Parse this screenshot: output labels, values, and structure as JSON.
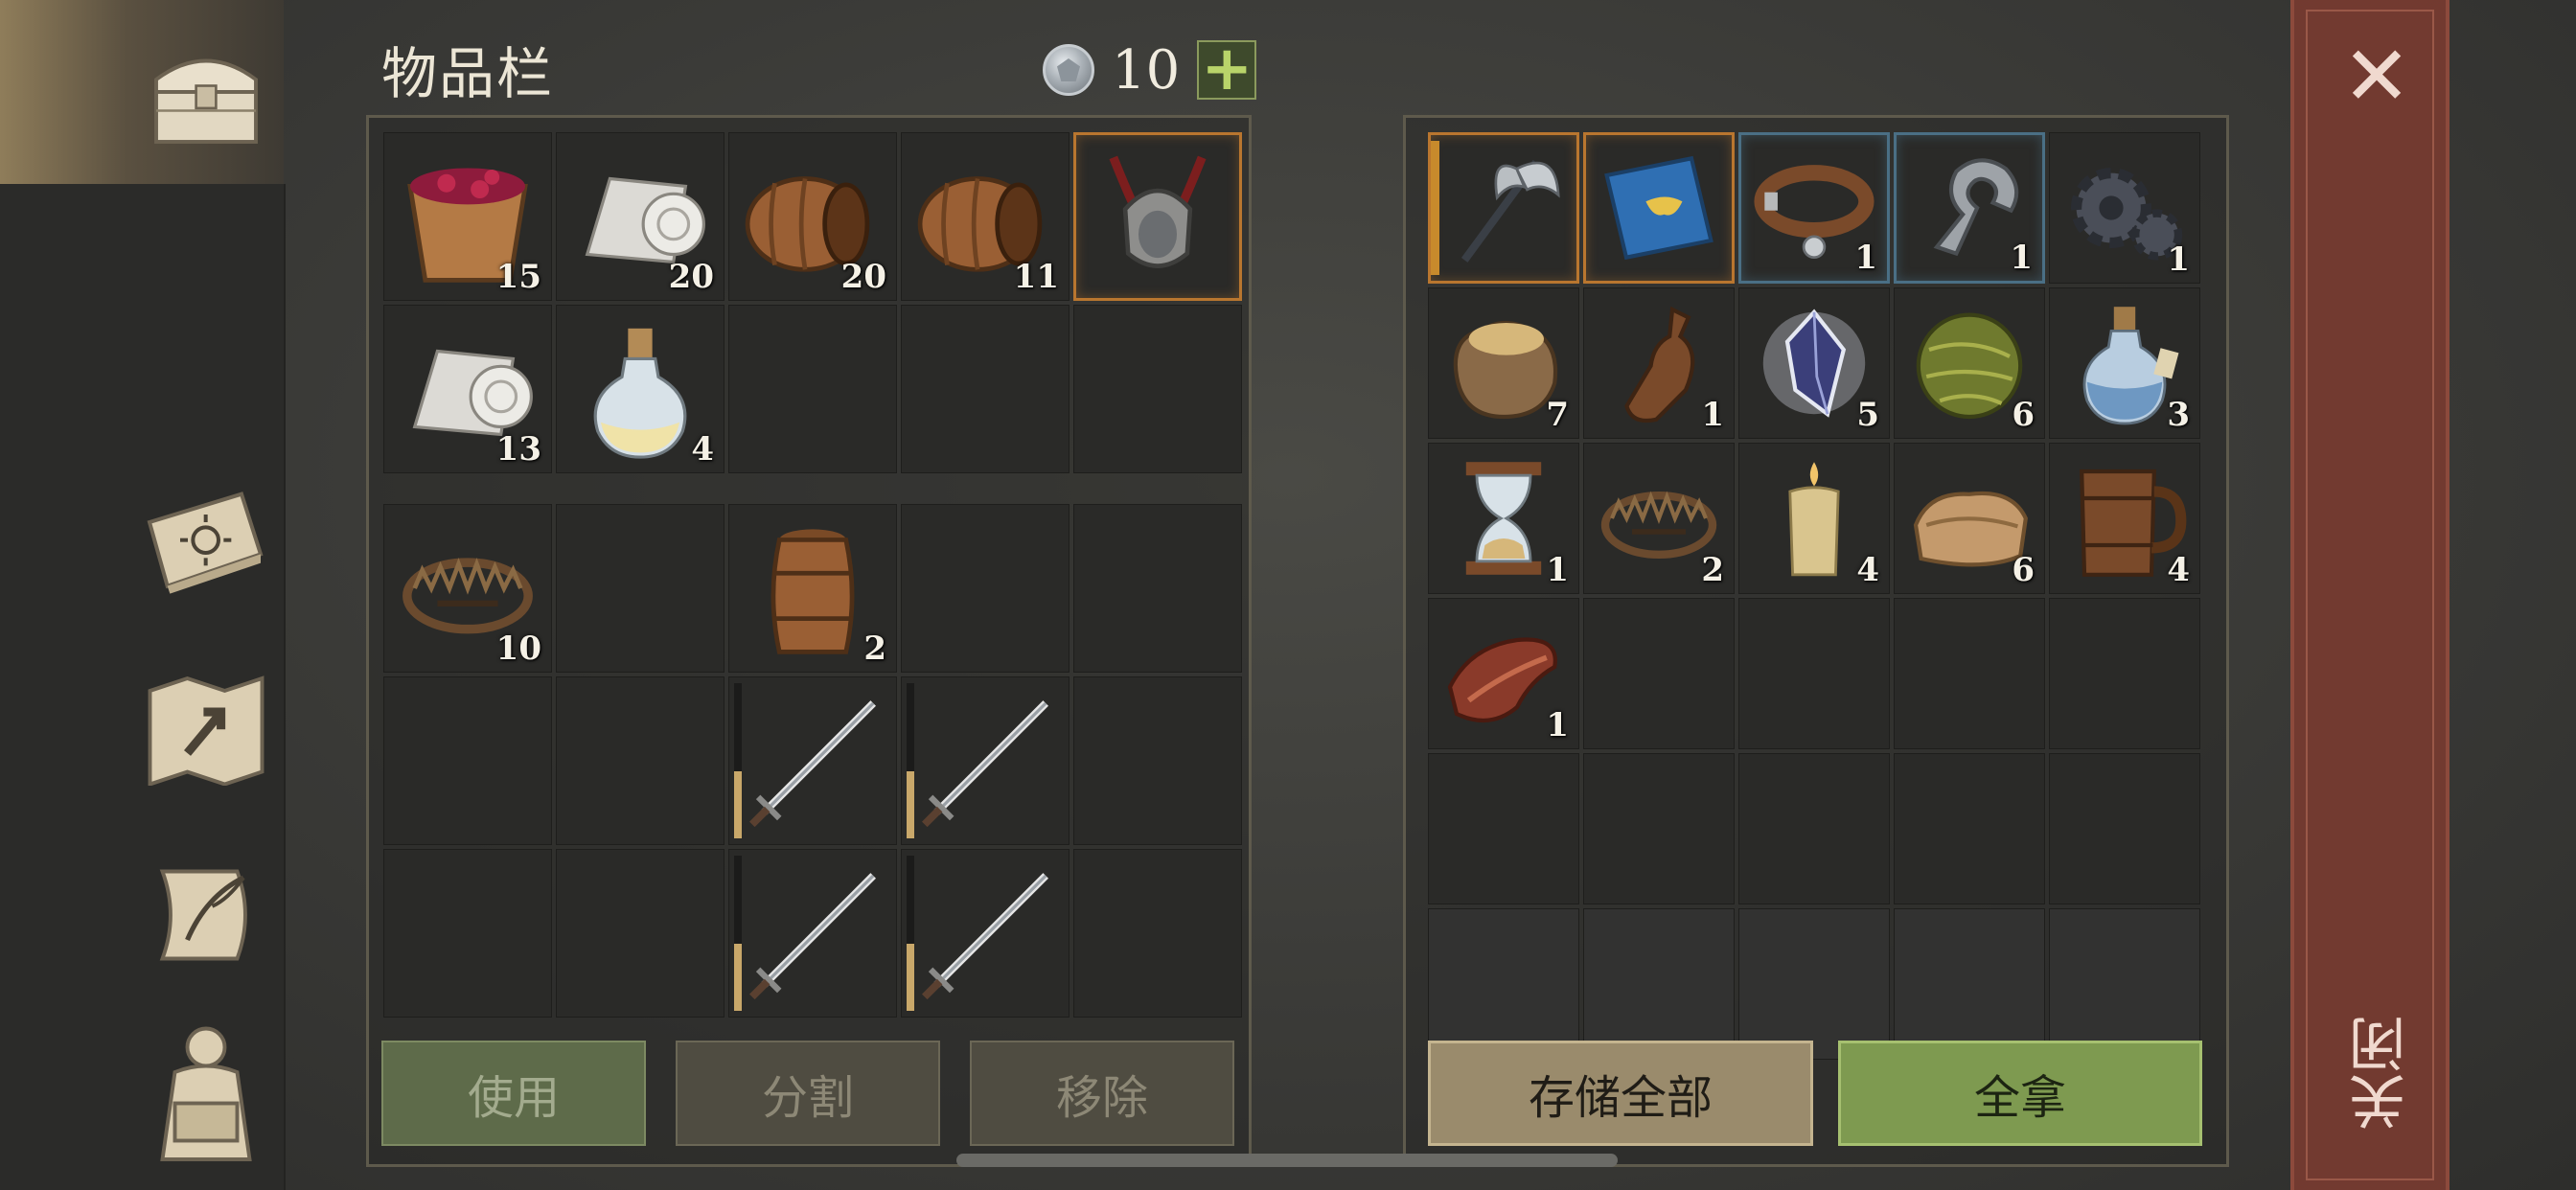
{
  "inventory": {
    "title": "物品栏",
    "currency_value": "10",
    "add_label": "+",
    "top_grid": [
      {
        "icon": "berry-bucket-icon",
        "qty": "15"
      },
      {
        "icon": "cloth-roll-icon",
        "qty": "20"
      },
      {
        "icon": "barrel-lying-icon",
        "qty": "20"
      },
      {
        "icon": "barrel-lying-icon",
        "qty": "11"
      },
      {
        "icon": "horned-helmet-icon",
        "qty": "",
        "highlight": "orange"
      },
      {
        "icon": "cloth-roll-icon",
        "qty": "13"
      },
      {
        "icon": "potion-icon",
        "qty": "4"
      },
      {
        "icon": "",
        "qty": ""
      },
      {
        "icon": "",
        "qty": ""
      },
      {
        "icon": "",
        "qty": ""
      }
    ],
    "bottom_grid": [
      {
        "icon": "bear-trap-icon",
        "qty": "10"
      },
      {
        "icon": "",
        "qty": ""
      },
      {
        "icon": "barrel-small-icon",
        "qty": "2"
      },
      {
        "icon": "",
        "qty": ""
      },
      {
        "icon": "",
        "qty": ""
      },
      {
        "icon": "",
        "qty": ""
      },
      {
        "icon": "",
        "qty": ""
      },
      {
        "icon": "sword-icon",
        "qty": "",
        "durability": 0.4
      },
      {
        "icon": "sword-icon",
        "qty": "",
        "durability": 0.3
      },
      {
        "icon": "",
        "qty": ""
      },
      {
        "icon": "",
        "qty": ""
      },
      {
        "icon": "",
        "qty": ""
      },
      {
        "icon": "sword-icon",
        "qty": "",
        "durability": 0.4
      },
      {
        "icon": "sword-icon",
        "qty": "",
        "durability": 0.4
      },
      {
        "icon": "",
        "qty": ""
      }
    ],
    "buttons": {
      "use": "使用",
      "split": "分割",
      "remove": "移除"
    }
  },
  "storage": {
    "grid": [
      {
        "icon": "battle-axe-icon",
        "qty": "",
        "highlight": "orange"
      },
      {
        "icon": "blue-book-icon",
        "qty": "",
        "highlight": "orange"
      },
      {
        "icon": "leather-collar-icon",
        "qty": "1",
        "highlight": "blue"
      },
      {
        "icon": "metal-clamp-icon",
        "qty": "1",
        "highlight": "blue"
      },
      {
        "icon": "gear-icon",
        "qty": "1"
      },
      {
        "icon": "grain-sack-icon",
        "qty": "7"
      },
      {
        "icon": "bottle-icon",
        "qty": "1"
      },
      {
        "icon": "crystal-shard-icon",
        "qty": "5"
      },
      {
        "icon": "grass-ball-icon",
        "qty": "6"
      },
      {
        "icon": "potion-blue-icon",
        "qty": "3"
      },
      {
        "icon": "hourglass-icon",
        "qty": "1"
      },
      {
        "icon": "bear-trap-icon",
        "qty": "2"
      },
      {
        "icon": "candle-icon",
        "qty": "4"
      },
      {
        "icon": "folded-cloth-icon",
        "qty": "6"
      },
      {
        "icon": "wooden-mug-icon",
        "qty": "4"
      },
      {
        "icon": "raw-meat-icon",
        "qty": "1"
      },
      {
        "icon": "",
        "qty": ""
      },
      {
        "icon": "",
        "qty": ""
      },
      {
        "icon": "",
        "qty": ""
      },
      {
        "icon": "",
        "qty": ""
      },
      {
        "icon": "",
        "qty": ""
      },
      {
        "icon": "",
        "qty": ""
      },
      {
        "icon": "",
        "qty": ""
      },
      {
        "icon": "",
        "qty": ""
      },
      {
        "icon": "",
        "qty": ""
      },
      {
        "icon": "",
        "qty": "",
        "faint": true
      },
      {
        "icon": "",
        "qty": "",
        "faint": true
      },
      {
        "icon": "",
        "qty": "",
        "faint": true
      },
      {
        "icon": "",
        "qty": "",
        "faint": true
      },
      {
        "icon": "",
        "qty": "",
        "faint": true
      }
    ],
    "buttons": {
      "store_all": "存储全部",
      "take_all": "全拿"
    }
  },
  "close": {
    "label": "关闭",
    "x": "✕"
  },
  "nav": [
    "chest-icon",
    "sun-book-icon",
    "map-icon",
    "scroll-quill-icon",
    "backpack-icon"
  ]
}
